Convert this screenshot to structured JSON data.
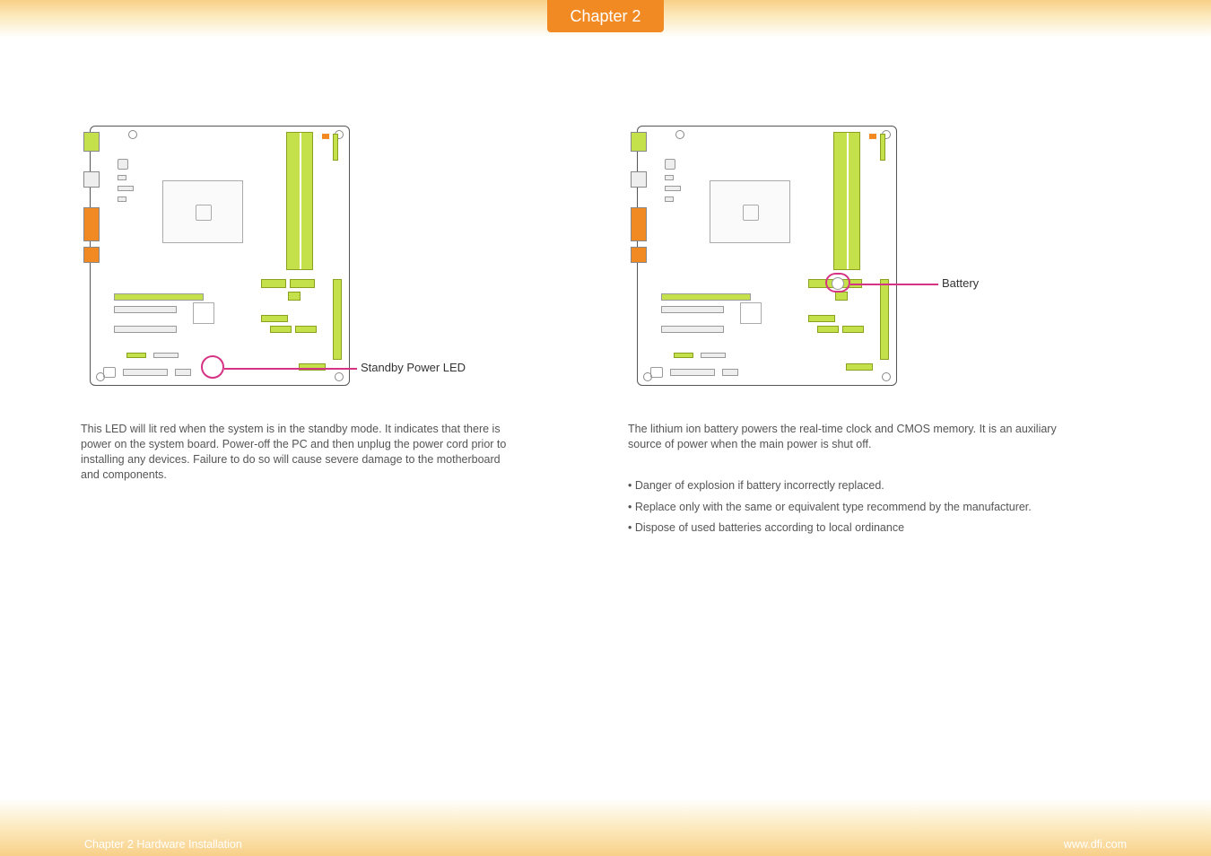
{
  "header": {
    "chapter_label": "Chapter 2"
  },
  "left": {
    "callout_label": "Standby Power LED",
    "body": "This LED will lit red when the system is in the standby mode. It indicates that there is power on the system board. Power-off the PC and then unplug the power cord prior to installing any devices. Failure to do so will cause severe damage to the motherboard and components."
  },
  "right": {
    "callout_label": "Battery",
    "body": "The lithium ion battery powers the real-time clock and CMOS memory. It is an auxiliary source of power when the main power is shut off.",
    "safety": [
      "• Danger of explosion if battery incorrectly replaced.",
      "• Replace only with the same or equivalent type recommend by the manufacturer.",
      "• Dispose of used batteries according to local ordinance"
    ]
  },
  "footer": {
    "left": "Chapter 2 Hardware Installation",
    "right": "www.dfi.com"
  }
}
